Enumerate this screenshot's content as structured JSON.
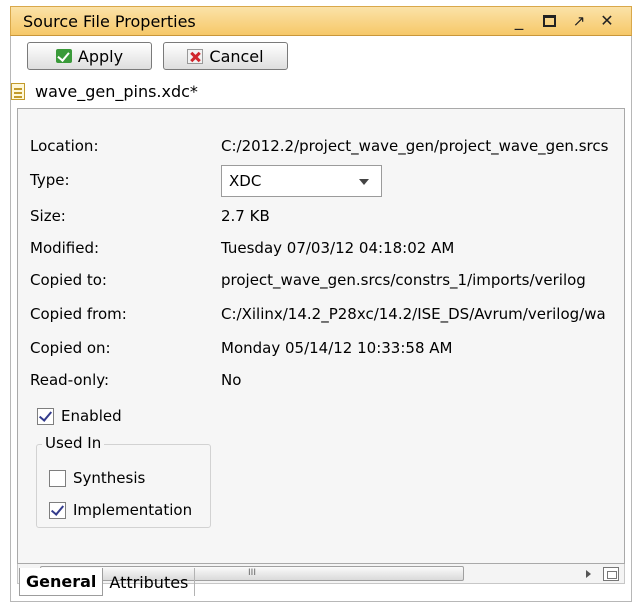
{
  "window": {
    "title": "Source File Properties"
  },
  "toolbar": {
    "apply_label": "Apply",
    "cancel_label": "Cancel"
  },
  "file": {
    "name": "wave_gen_pins.xdc*"
  },
  "properties": [
    {
      "label": "Location:",
      "value": "C:/2012.2/project_wave_gen/project_wave_gen.srcs"
    },
    {
      "label": "Type:",
      "value": "XDC"
    },
    {
      "label": "Size:",
      "value": "2.7 KB"
    },
    {
      "label": "Modified:",
      "value": "Tuesday 07/03/12 04:18:02 AM"
    },
    {
      "label": "Copied to:",
      "value": "project_wave_gen.srcs/constrs_1/imports/verilog"
    },
    {
      "label": "Copied from:",
      "value": "C:/Xilinx/14.2_P28xc/14.2/ISE_DS/Avrum/verilog/wa"
    },
    {
      "label": "Copied on:",
      "value": "Monday 05/14/12 10:33:58 AM"
    },
    {
      "label": "Read-only:",
      "value": "No"
    }
  ],
  "enabled": {
    "label": "Enabled",
    "checked": true
  },
  "used_in": {
    "title": "Used In",
    "options": [
      {
        "label": "Synthesis",
        "checked": false
      },
      {
        "label": "Implementation",
        "checked": true
      }
    ]
  },
  "scrollbar": {
    "thumb_grip": "III"
  },
  "tabs": [
    {
      "label": "General",
      "active": true
    },
    {
      "label": "Attributes",
      "active": false
    }
  ]
}
